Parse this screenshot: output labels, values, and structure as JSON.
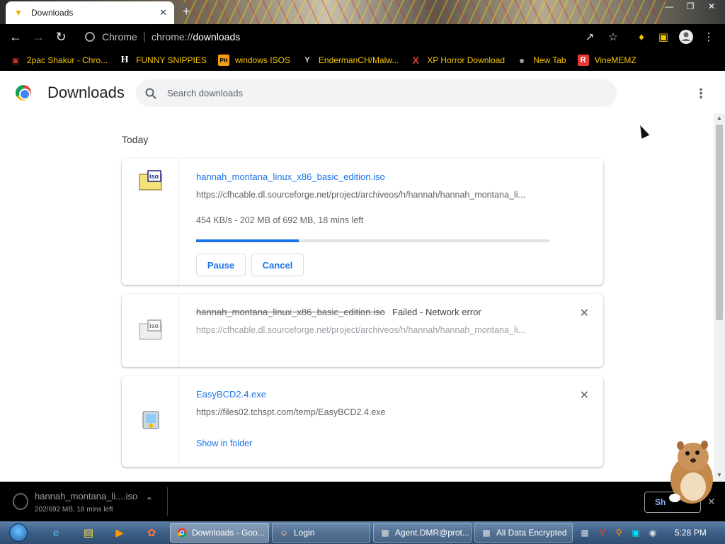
{
  "browser": {
    "tab_title": "Downloads",
    "site_label": "Chrome",
    "url_scheme": "chrome://",
    "url_host": "downloads"
  },
  "bookmarks": [
    {
      "label": "2pac Shakur - Chro...",
      "icon": "bag-icon",
      "icon_text": "▣",
      "icon_color": "#c0392b"
    },
    {
      "label": "FUNNY SNIPPIES",
      "icon": "h-logo-icon",
      "icon_text": "H",
      "icon_color": "#ffffff"
    },
    {
      "label": "windows ISOS",
      "icon": "ph-logo-icon",
      "icon_text": "PH",
      "icon_color": "#f39c12"
    },
    {
      "label": "EndermanCH/Malw...",
      "icon": "yp-logo-icon",
      "icon_text": "Y",
      "icon_color": "#dddddd"
    },
    {
      "label": "XP Horror Download",
      "icon": "x-logo-icon",
      "icon_text": "X",
      "icon_color": "#e53935"
    },
    {
      "label": "New Tab",
      "icon": "globe-icon",
      "icon_text": "●",
      "icon_color": "#9e9e9e"
    },
    {
      "label": "VineMEMZ",
      "icon": "r-logo-icon",
      "icon_text": "R",
      "icon_color": "#e53935"
    }
  ],
  "page": {
    "title": "Downloads",
    "search_placeholder": "Search downloads",
    "date_header": "Today"
  },
  "downloads": [
    {
      "filename": "hannah_montana_linux_x86_basic_edition.iso",
      "url": "https://cfhcable.dl.sourceforge.net/project/archiveos/h/hannah/hannah_montana_li...",
      "status": "454 KB/s - 202 MB of 692 MB, 18 mins left",
      "progress_fraction": 0.29,
      "pause_label": "Pause",
      "cancel_label": "Cancel"
    },
    {
      "filename": "hannah_montana_linux_x86_basic_edition.iso",
      "url": "https://cfhcable.dl.sourceforge.net/project/archiveos/h/hannah/hannah_montana_li...",
      "status": "Failed - Network error"
    },
    {
      "filename": "EasyBCD2.4.exe",
      "url": "https://files02.tchspt.com/temp/EasyBCD2.4.exe",
      "action": "Show in folder"
    }
  ],
  "shelf": {
    "filename": "hannah_montana_li....iso",
    "status": "202/692 MB, 18 mins left",
    "show_all_label": "Sh"
  },
  "taskbar": {
    "tasks": [
      {
        "label": "Downloads - Goo...",
        "icon": "chrome-icon"
      },
      {
        "label": "Login",
        "icon": "login-app-icon"
      },
      {
        "label": "Agent.DMR@prot...",
        "icon": "window-icon"
      },
      {
        "label": "All Data Encrypted",
        "icon": "window-icon"
      }
    ],
    "clock": "5:28 PM"
  },
  "colors": {
    "accent": "#1a73e8",
    "bookmark_text": "#f4c400",
    "toolbar_bg": "#000000"
  }
}
